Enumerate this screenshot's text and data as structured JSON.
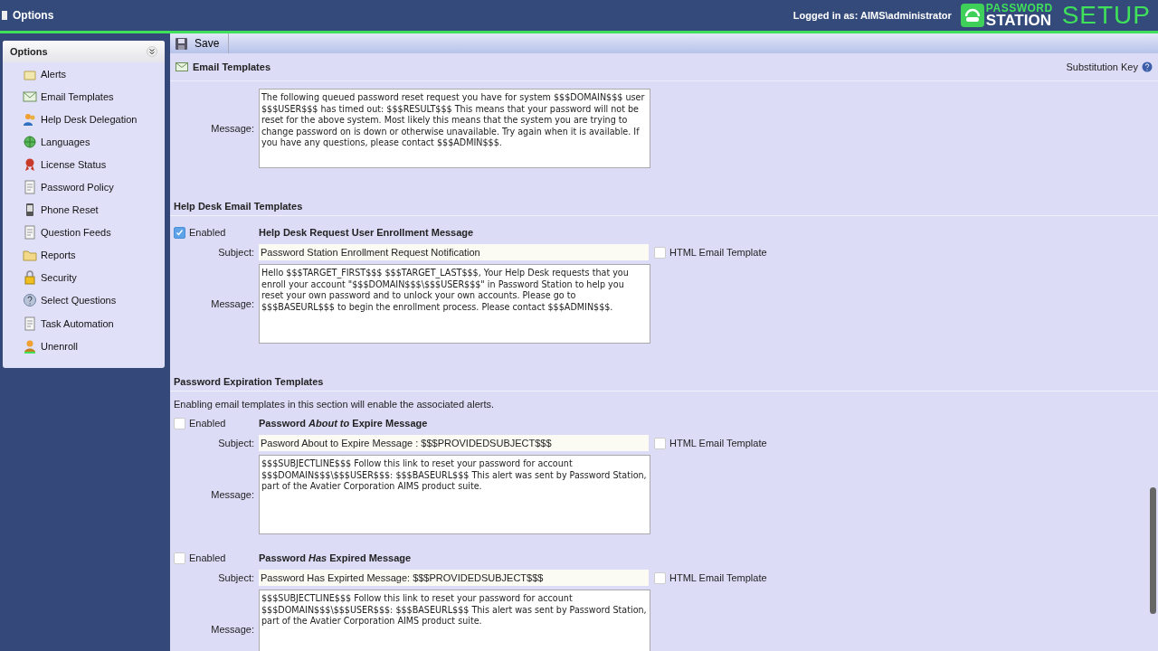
{
  "app_bar": {
    "title": "Options",
    "login": "Logged in as: AIMS\\administrator",
    "logo_top": "PASSWORD",
    "logo_bottom": "STATION",
    "setup": "SETUP"
  },
  "sidebar": {
    "title": "Options",
    "items": [
      {
        "label": "Alerts"
      },
      {
        "label": "Email Templates"
      },
      {
        "label": "Help Desk Delegation"
      },
      {
        "label": "Languages"
      },
      {
        "label": "License Status"
      },
      {
        "label": "Password Policy"
      },
      {
        "label": "Phone Reset"
      },
      {
        "label": "Question Feeds"
      },
      {
        "label": "Reports"
      },
      {
        "label": "Security"
      },
      {
        "label": "Select Questions"
      },
      {
        "label": "Task Automation"
      },
      {
        "label": "Unenroll"
      }
    ]
  },
  "toolbar": {
    "save": "Save"
  },
  "sections": [
    {
      "kind": "header",
      "title": "Email Templates",
      "help": "Substitution Key",
      "templates": [
        {
          "message_label": "Message:",
          "message": "The following queued password reset request you have for system $$$DOMAIN$$$ user $$$USER$$$ has timed out: $$$RESULT$$$ This means that your password will not be reset for the above system. Most likely this means that the system you are trying to change password on is down or otherwise unavailable. Try again when it is available. If you have any questions, please contact $$$ADMIN$$$."
        }
      ]
    },
    {
      "kind": "group",
      "title": "Help Desk Email Templates",
      "templates": [
        {
          "enabled_label": "Enabled",
          "enabled": true,
          "name": "Help Desk Request User Enrollment Message",
          "subject_label": "Subject:",
          "subject": "Password Station Enrollment Request Notification",
          "html_label": "HTML Email Template",
          "html": false,
          "message_label": "Message:",
          "message": "Hello $$$TARGET_FIRST$$$ $$$TARGET_LAST$$$, Your Help Desk requests that you enroll your account \"$$$DOMAIN$$$\\$$$USER$$$\" in Password Station to help you reset your own password and to unlock your own accounts. Please go to $$$BASEURL$$$ to begin the enrollment process. Please contact $$$ADMIN$$$."
        }
      ]
    },
    {
      "kind": "group",
      "title": "Password Expiration Templates",
      "description": "Enabling email templates in this section will enable the associated alerts.",
      "templates": [
        {
          "enabled_label": "Enabled",
          "enabled": false,
          "name": "Password *About to* Expire Message",
          "subject_label": "Subject:",
          "subject": "Pasword About to Expire Message : $$$PROVIDEDSUBJECT$$$",
          "html_label": "HTML Email Template",
          "html": false,
          "message_label": "Message:",
          "message": "$$$SUBJECTLINE$$$ Follow this link to reset your password for account $$$DOMAIN$$$\\$$$USER$$$: $$$BASEURL$$$ This alert was sent by Password Station, part of the Avatier Corporation AIMS product suite."
        },
        {
          "enabled_label": "Enabled",
          "enabled": false,
          "name": "Password *Has* Expired Message",
          "subject_label": "Subject:",
          "subject": "Password Has Expirted Message: $$$PROVIDEDSUBJECT$$$",
          "html_label": "HTML Email Template",
          "html": false,
          "message_label": "Message:",
          "message": "$$$SUBJECTLINE$$$ Follow this link to reset your password for account $$$DOMAIN$$$\\$$$USER$$$: $$$BASEURL$$$ This alert was sent by Password Station, part of the Avatier Corporation AIMS product suite."
        }
      ]
    }
  ]
}
